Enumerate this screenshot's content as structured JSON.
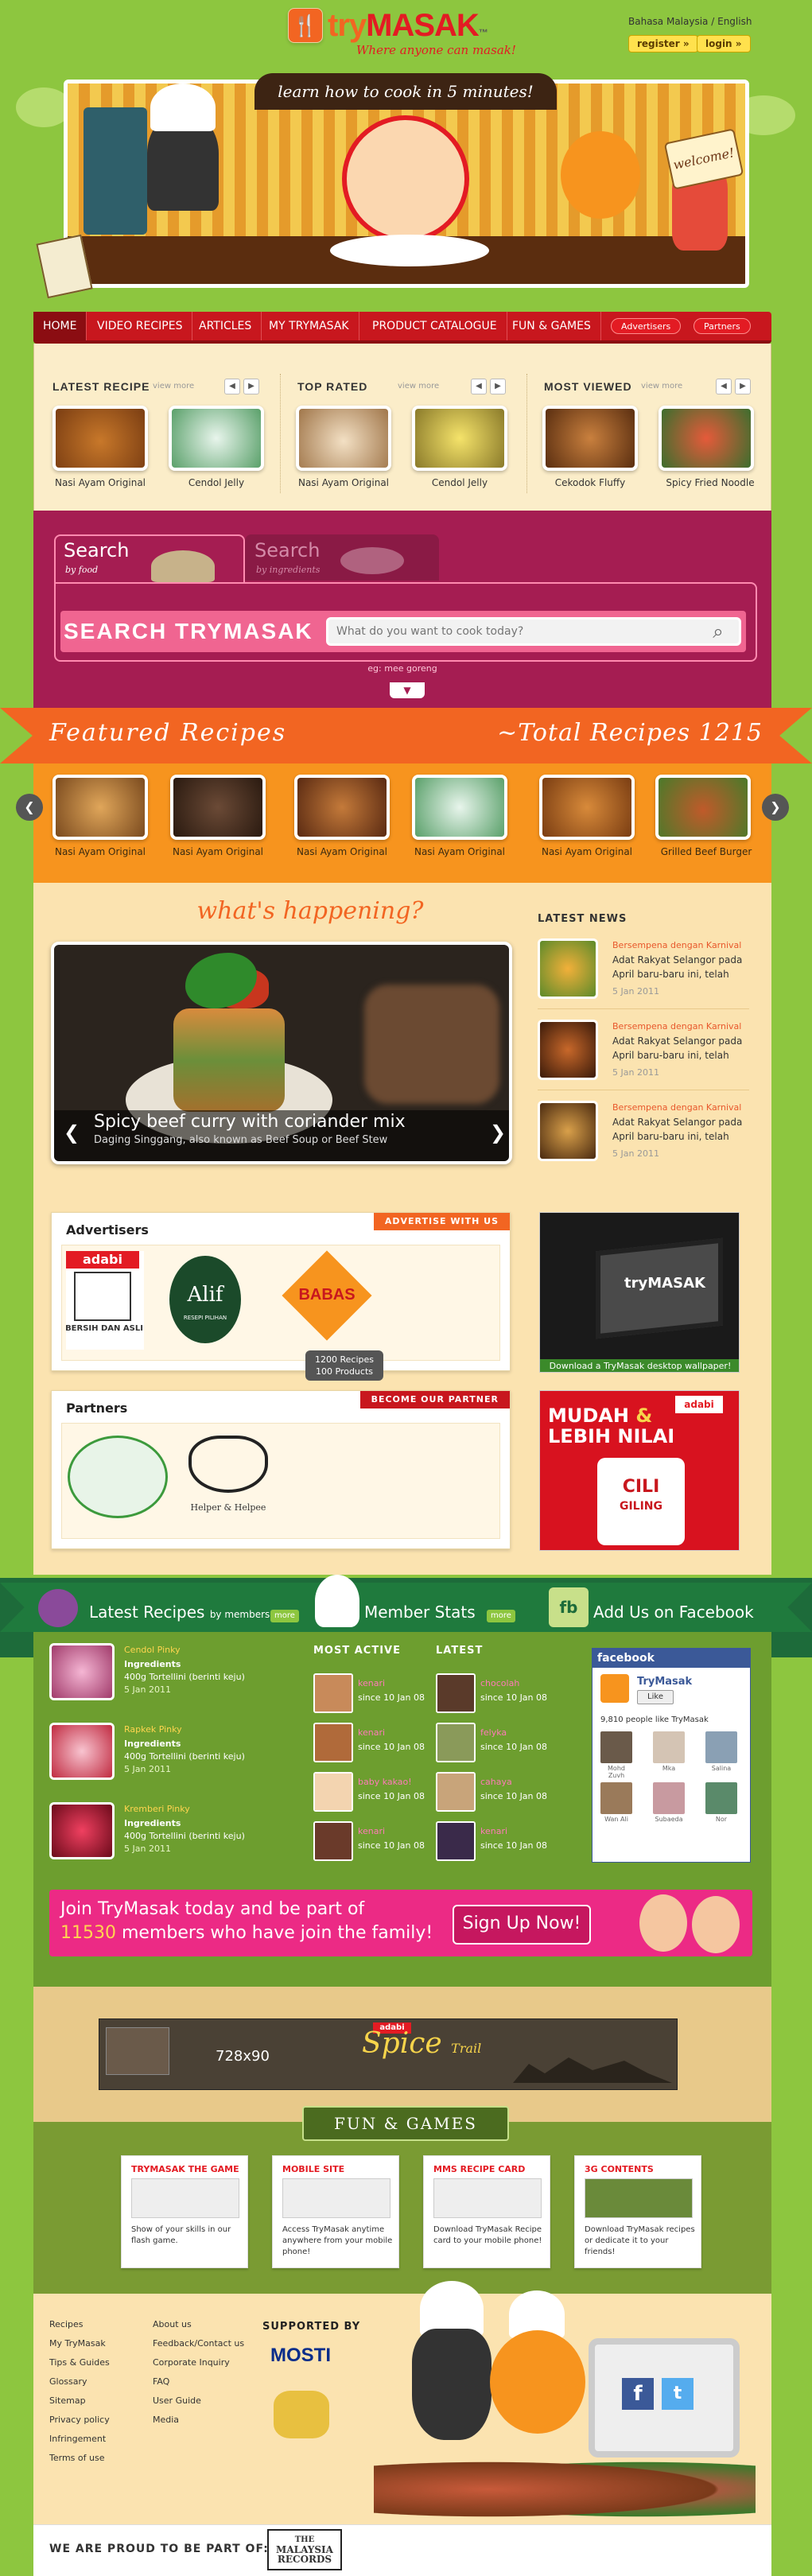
{
  "header": {
    "logo_text_a": "try",
    "logo_text_b": "MASAK",
    "logo_tm": "™",
    "logo_tagline": "Where anyone can masak!",
    "lang_malay": "Bahasa Malaysia",
    "lang_sep": "/",
    "lang_english": "English",
    "register_label": "register »",
    "login_label": "login »",
    "banner_tagline": "learn how to cook in 5 minutes!",
    "welcome_sign": "welcome!"
  },
  "nav": {
    "items": [
      "HOME",
      "VIDEO RECIPES",
      "ARTICLES",
      "MY TRYMASAK",
      "PRODUCT CATALOGUE",
      "FUN & GAMES"
    ],
    "pills": [
      "Advertisers",
      "Partners"
    ]
  },
  "recipes": {
    "view_more": "view more",
    "latest": {
      "title": "LATEST RECIPE",
      "items": [
        "Nasi Ayam Original",
        "Cendol Jelly"
      ]
    },
    "top": {
      "title": "TOP RATED",
      "items": [
        "Nasi Ayam Original",
        "Cendol Jelly"
      ]
    },
    "viewed": {
      "title": "MOST VIEWED",
      "items": [
        "Cekodok Fluffy",
        "Spicy Fried Noodle"
      ]
    }
  },
  "search": {
    "tab_food_title": "Search",
    "tab_food_sub": "by food",
    "tab_ingr_title": "Search",
    "tab_ingr_sub": "by ingredients",
    "bar_label": "SEARCH TRYMASAK",
    "placeholder": "What do you want to cook today?",
    "example": "eg: mee goreng",
    "expand_icon": "chevron-down-icon"
  },
  "featured": {
    "title": "Featured Recipes",
    "total": "~Total Recipes 1215",
    "items": [
      "Nasi Ayam Original",
      "Nasi Ayam Original",
      "Nasi Ayam Original",
      "Nasi Ayam Original",
      "Nasi Ayam Original",
      "Grilled Beef Burger"
    ]
  },
  "happening": {
    "title": "what's happening?",
    "slide_title": "Spicy beef curry with coriander mix",
    "slide_sub": "Daging Singgang, also known as Beef Soup or Beef Stew",
    "news_title": "LATEST NEWS",
    "news": [
      {
        "title": "Bersempena dengan Karnival",
        "body": "Adat Rakyat Selangor pada April baru-baru ini, telah",
        "date": "5 Jan 2011"
      },
      {
        "title": "Bersempena dengan Karnival",
        "body": "Adat Rakyat Selangor pada April baru-baru ini, telah",
        "date": "5 Jan 2011"
      },
      {
        "title": "Bersempena dengan Karnival",
        "body": "Adat Rakyat Selangor pada April baru-baru ini, telah",
        "date": "5 Jan 2011"
      }
    ]
  },
  "advertisers": {
    "title": "Advertisers",
    "badge": "ADVERTISE WITH US",
    "logos": [
      "adabi",
      "BERSIH DAN ASLI",
      "Alif",
      "RESEPI PILIHAN",
      "BABAS"
    ],
    "tooltip_a": "1200 Recipes",
    "tooltip_b": "100 Products",
    "wallpaper_caption": "Download a TryMasak desktop wallpaper!",
    "wallpaper_logo": "tryMASAK"
  },
  "partners": {
    "title": "Partners",
    "badge": "BECOME OUR PARTNER",
    "helper": "Helper & Helpee",
    "ad_line1": "MUDAH",
    "ad_amp": "&",
    "ad_line2": "LEBIH NILAI",
    "ad_brand": "adabi",
    "ad_product_a": "CILI",
    "ad_product_b": "GILING"
  },
  "members": {
    "latest_title": "Latest Recipes",
    "latest_by": "by members",
    "more": "more",
    "stats_title": "Member Stats",
    "fb_title": "Add Us on Facebook",
    "recipes": [
      {
        "title": "Cendol Pinky",
        "label": "Ingredients",
        "body": "400g Tortellini (berinti keju)",
        "date": "5 Jan 2011"
      },
      {
        "title": "Rapkek Pinky",
        "label": "Ingredients",
        "body": "400g Tortellini (berinti keju)",
        "date": "5 Jan 2011"
      },
      {
        "title": "Kremberi Pinky",
        "label": "Ingredients",
        "body": "400g Tortellini (berinti keju)",
        "date": "5 Jan 2011"
      }
    ],
    "active_title": "MOST ACTIVE",
    "latest_members_title": "LATEST",
    "active": [
      {
        "name": "kenari",
        "since": "since 10 Jan 08"
      },
      {
        "name": "kenari",
        "since": "since 10 Jan 08"
      },
      {
        "name": "baby kakao!",
        "since": "since 10 Jan 08"
      },
      {
        "name": "kenari",
        "since": "since 10 Jan 08"
      }
    ],
    "newest": [
      {
        "name": "chocolah",
        "since": "since 10 Jan 08"
      },
      {
        "name": "felyka",
        "since": "since 10 Jan 08"
      },
      {
        "name": "cahaya",
        "since": "since 10 Jan 08"
      },
      {
        "name": "kenari",
        "since": "since 10 Jan 08"
      }
    ]
  },
  "facebook": {
    "header": "facebook",
    "page_name": "TryMasak",
    "like": "Like",
    "count": "9,810 people like TryMasak",
    "fans": [
      "Mohd Zuvh",
      "Mka",
      "Salina",
      "Wan Ali",
      "Subaeda",
      "Nor"
    ]
  },
  "join": {
    "line1": "Join TryMasak today and be part of",
    "count": "11530",
    "line2": "members who have join the family!",
    "signup": "Sign Up Now!"
  },
  "ad": {
    "size": "728x90",
    "brand": "adabi",
    "title": "Spice",
    "sub": "Trail"
  },
  "fun": {
    "title": "FUN & GAMES",
    "cards": [
      {
        "head": "TRYMASAK THE GAME",
        "desc": "Show of your skills in our flash game."
      },
      {
        "head": "MOBILE SITE",
        "desc": "Access TryMasak anytime anywhere from your mobile phone!"
      },
      {
        "head": "MMS RECIPE CARD",
        "desc": "Download TryMasak Recipe card to your mobile phone!"
      },
      {
        "head": "3G CONTENTS",
        "desc": "Download TryMasak recipes or dedicate it to your friends!"
      }
    ]
  },
  "footer": {
    "col1": [
      "Recipes",
      "My TryMasak",
      "Tips & Guides",
      "Glossary",
      "Sitemap",
      "Privacy policy",
      "Infringement",
      "Terms of use"
    ],
    "col2": [
      "About us",
      "Feedback/Contact us",
      "Corporate Inquiry",
      "FAQ",
      "User Guide",
      "Media"
    ],
    "supported": "SUPPORTED BY",
    "mosti": "MOSTI",
    "proud": "WE ARE PROUD TO BE PART OF:",
    "records_a": "THE",
    "records_b": "MALAYSIA",
    "records_c": "RECORDS"
  },
  "colors": {
    "brand_orange": "#f26522",
    "brand_red": "#e31b23",
    "page_green": "#8dc63f",
    "search_magenta": "#a51d52",
    "join_pink": "#ec2a85"
  }
}
